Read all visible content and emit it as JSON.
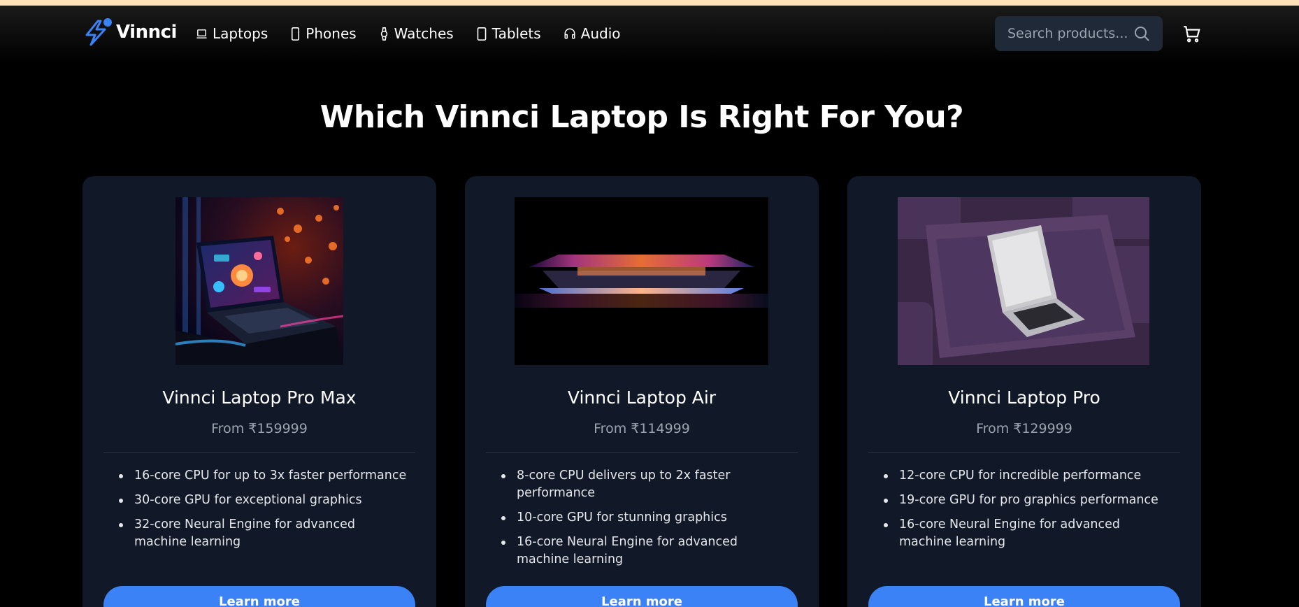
{
  "brand": {
    "name": "Vinnci",
    "accent": "#3b82f6"
  },
  "nav": {
    "links": [
      {
        "label": "Laptops",
        "icon": "laptop-icon"
      },
      {
        "label": "Phones",
        "icon": "phone-icon"
      },
      {
        "label": "Watches",
        "icon": "watch-icon"
      },
      {
        "label": "Tablets",
        "icon": "tablet-icon"
      },
      {
        "label": "Audio",
        "icon": "headphones-icon"
      }
    ],
    "search_placeholder": "Search products...",
    "cart_icon": "cart-icon"
  },
  "page": {
    "title": "Which Vinnci Laptop Is Right For You?"
  },
  "products": [
    {
      "name": "Vinnci Laptop Pro Max",
      "price": "From ₹159999",
      "features": [
        "16-core CPU for up to 3x faster performance",
        "30-core GPU for exceptional graphics",
        "32-core Neural Engine for advanced machine learning"
      ],
      "button": "Learn more"
    },
    {
      "name": "Vinnci Laptop Air",
      "price": "From ₹114999",
      "features": [
        "8-core CPU delivers up to 2x faster performance",
        "10-core GPU for stunning graphics",
        "16-core Neural Engine for advanced machine learning"
      ],
      "button": "Learn more"
    },
    {
      "name": "Vinnci Laptop Pro",
      "price": "From ₹129999",
      "features": [
        "12-core CPU for incredible performance",
        "19-core GPU for pro graphics performance",
        "16-core Neural Engine for advanced machine learning"
      ],
      "button": "Learn more"
    }
  ]
}
